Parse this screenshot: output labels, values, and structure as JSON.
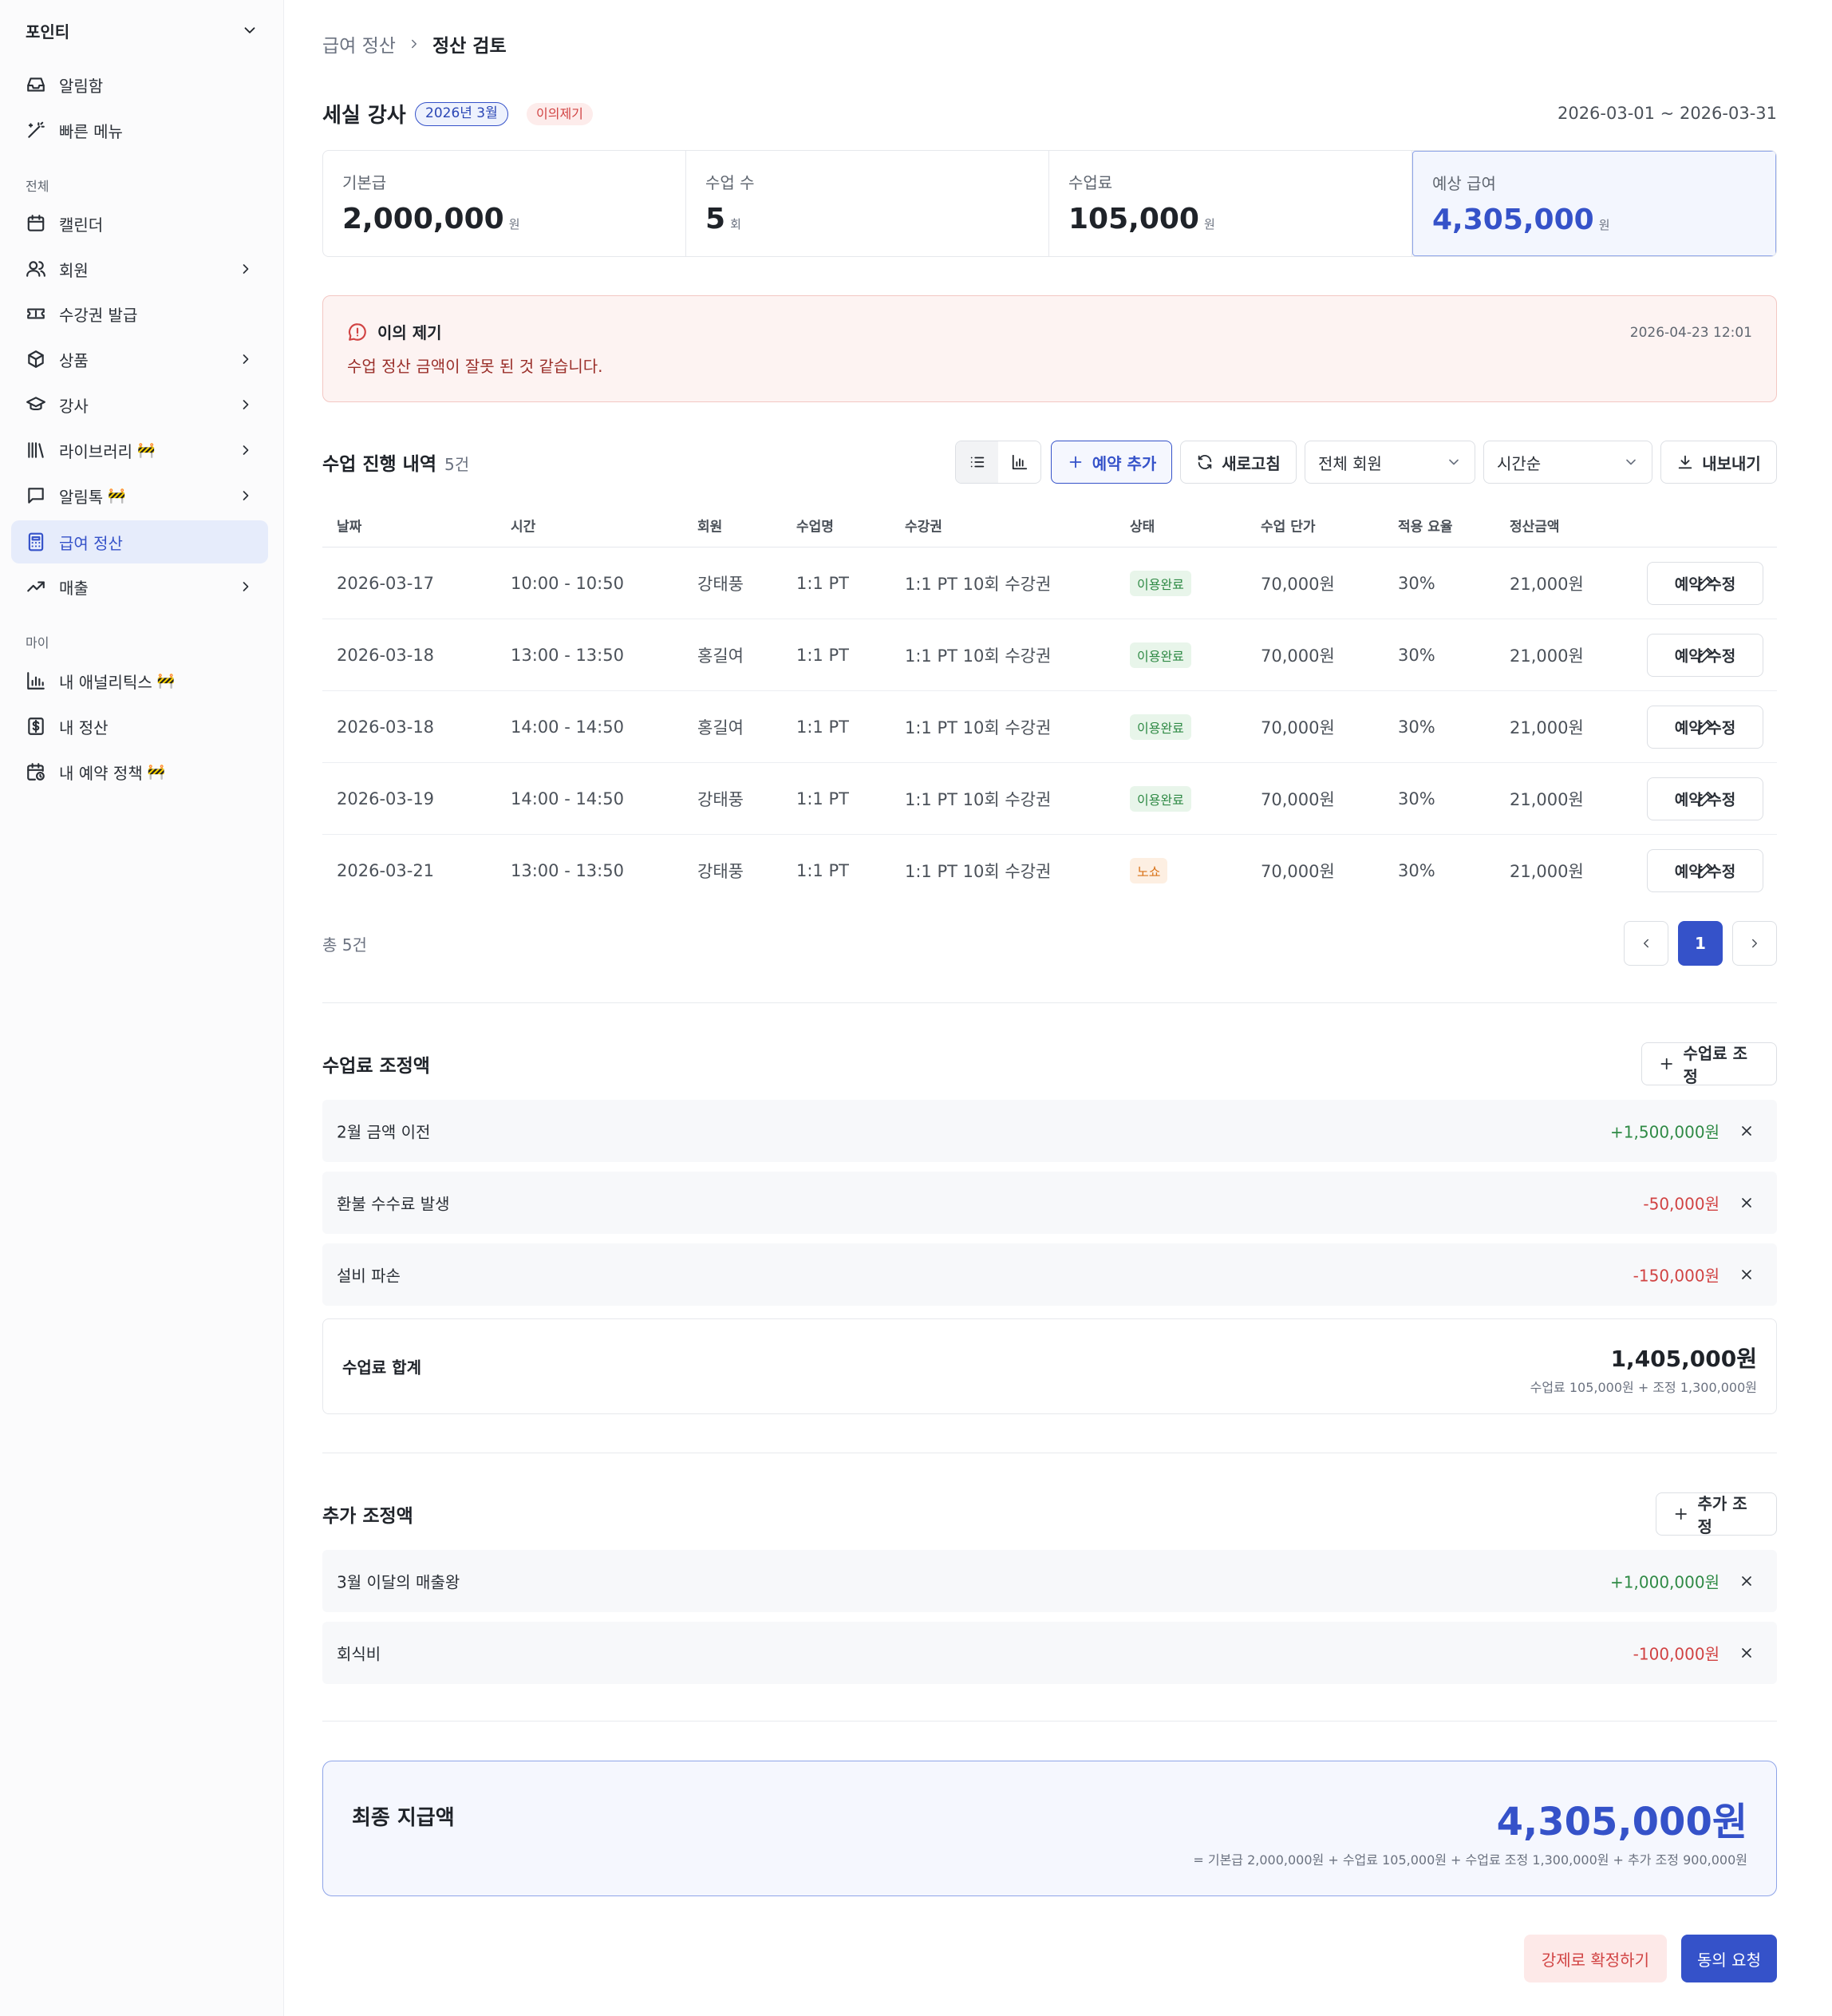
{
  "sidebar": {
    "workspace": "포인티",
    "top_items": [
      {
        "label": "알림함",
        "icon": "inbox-icon"
      },
      {
        "label": "빠른 메뉴",
        "icon": "magic-wand-icon"
      }
    ],
    "section_all": "전체",
    "items": [
      {
        "label": "캘린더",
        "icon": "calendar-icon",
        "chevron": false
      },
      {
        "label": "회원",
        "icon": "users-icon",
        "chevron": true
      },
      {
        "label": "수강권 발급",
        "icon": "ticket-icon",
        "chevron": false
      },
      {
        "label": "상품",
        "icon": "box-icon",
        "chevron": true
      },
      {
        "label": "강사",
        "icon": "graduation-cap-icon",
        "chevron": true
      },
      {
        "label": "라이브러리",
        "icon": "library-icon",
        "chevron": true,
        "badge": "🚧"
      },
      {
        "label": "알림톡",
        "icon": "message-icon",
        "chevron": true,
        "badge": "🚧"
      },
      {
        "label": "급여 정산",
        "icon": "calculator-icon",
        "chevron": false,
        "active": true
      },
      {
        "label": "매출",
        "icon": "trending-up-icon",
        "chevron": true
      }
    ],
    "section_my": "마이",
    "my_items": [
      {
        "label": "내 애널리틱스",
        "icon": "bar-chart-icon",
        "badge": "🚧"
      },
      {
        "label": "내 정산",
        "icon": "dollar-icon"
      },
      {
        "label": "내 예약 정책",
        "icon": "calendar-clock-icon",
        "badge": "🚧"
      }
    ]
  },
  "breadcrumb": {
    "parent": "급여 정산",
    "current": "정산 검토"
  },
  "header": {
    "name": "세실 강사",
    "period": "2026년 3월",
    "status": "이의제기",
    "range": "2026-03-01 ~ 2026-03-31"
  },
  "stats": [
    {
      "label": "기본급",
      "value": "2,000,000",
      "unit": "원"
    },
    {
      "label": "수업 수",
      "value": "5",
      "unit": "회"
    },
    {
      "label": "수업료",
      "value": "105,000",
      "unit": "원"
    },
    {
      "label": "예상 급여",
      "value": "4,305,000",
      "unit": "원"
    }
  ],
  "dispute": {
    "title": "이의 제기",
    "message": "수업 정산 금액이 잘못 된 것 같습니다.",
    "time": "2026-04-23 12:01"
  },
  "sessions": {
    "title": "수업 진행 내역",
    "count": "5건",
    "toolbar": {
      "add": "예약 추가",
      "refresh": "새로고침",
      "member_filter": "전체 회원",
      "sort": "시간순",
      "export": "내보내기"
    },
    "columns": [
      "날짜",
      "시간",
      "회원",
      "수업명",
      "수강권",
      "상태",
      "수업 단가",
      "적용 요율",
      "정산금액"
    ],
    "rows": [
      {
        "date": "2026-03-17",
        "time": "10:00 - 10:50",
        "member": "강태풍",
        "class": "1:1 PT",
        "pass": "1:1 PT 10회 수강권",
        "status": "이용완료",
        "status_type": "done",
        "price": "70,000원",
        "rate": "30%",
        "amount": "21,000원"
      },
      {
        "date": "2026-03-18",
        "time": "13:00 - 13:50",
        "member": "홍길여",
        "class": "1:1 PT",
        "pass": "1:1 PT 10회 수강권",
        "status": "이용완료",
        "status_type": "done",
        "price": "70,000원",
        "rate": "30%",
        "amount": "21,000원"
      },
      {
        "date": "2026-03-18",
        "time": "14:00 - 14:50",
        "member": "홍길여",
        "class": "1:1 PT",
        "pass": "1:1 PT 10회 수강권",
        "status": "이용완료",
        "status_type": "done",
        "price": "70,000원",
        "rate": "30%",
        "amount": "21,000원"
      },
      {
        "date": "2026-03-19",
        "time": "14:00 - 14:50",
        "member": "강태풍",
        "class": "1:1 PT",
        "pass": "1:1 PT 10회 수강권",
        "status": "이용완료",
        "status_type": "done",
        "price": "70,000원",
        "rate": "30%",
        "amount": "21,000원"
      },
      {
        "date": "2026-03-21",
        "time": "13:00 - 13:50",
        "member": "강태풍",
        "class": "1:1 PT",
        "pass": "1:1 PT 10회 수강권",
        "status": "노쇼",
        "status_type": "noshow",
        "price": "70,000원",
        "rate": "30%",
        "amount": "21,000원"
      }
    ],
    "edit_label": "예약 수정",
    "total": "총 5건",
    "page": "1"
  },
  "fee_adjust": {
    "title": "수업료 조정액",
    "add_label": "수업료 조정",
    "items": [
      {
        "label": "2월 금액 이전",
        "amount": "+1,500,000원",
        "sign": "plus"
      },
      {
        "label": "환불 수수료 발생",
        "amount": "-50,000원",
        "sign": "minus"
      },
      {
        "label": "설비 파손",
        "amount": "-150,000원",
        "sign": "minus"
      }
    ],
    "sum_label": "수업료 합계",
    "sum_value": "1,405,000원",
    "sum_detail": "수업료 105,000원 + 조정 1,300,000원"
  },
  "extra_adjust": {
    "title": "추가 조정액",
    "add_label": "추가 조정",
    "items": [
      {
        "label": "3월 이달의 매출왕",
        "amount": "+1,000,000원",
        "sign": "plus"
      },
      {
        "label": "회식비",
        "amount": "-100,000원",
        "sign": "minus"
      }
    ]
  },
  "final": {
    "label": "최종 지급액",
    "value": "4,305,000원",
    "detail": "= 기본급 2,000,000원 + 수업료 105,000원 + 수업료 조정 1,300,000원 + 추가 조정 900,000원"
  },
  "actions": {
    "force": "강제로 확정하기",
    "agree": "동의 요청"
  },
  "colors": {
    "accent": "#3552c9",
    "plus": "#2f8a45",
    "minus": "#d14343",
    "noshow": "#d9741b"
  }
}
